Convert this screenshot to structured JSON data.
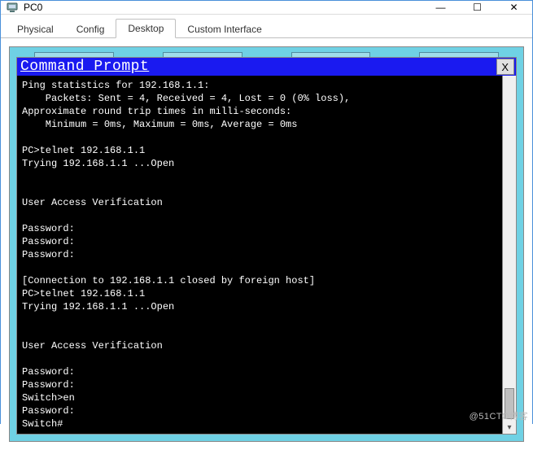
{
  "window": {
    "title": "PC0",
    "controls": {
      "minimize": "—",
      "maximize": "☐",
      "close": "✕"
    }
  },
  "tabs": [
    {
      "label": "Physical"
    },
    {
      "label": "Config"
    },
    {
      "label": "Desktop"
    },
    {
      "label": "Custom Interface"
    }
  ],
  "active_tab": "Desktop",
  "cmd": {
    "title": "Command Prompt",
    "close_label": "X",
    "lines": "Ping statistics for 192.168.1.1:\n    Packets: Sent = 4, Received = 4, Lost = 0 (0% loss),\nApproximate round trip times in milli-seconds:\n    Minimum = 0ms, Maximum = 0ms, Average = 0ms\n\nPC>telnet 192.168.1.1\nTrying 192.168.1.1 ...Open\n\n\nUser Access Verification\n\nPassword: \nPassword: \nPassword: \n\n[Connection to 192.168.1.1 closed by foreign host]\nPC>telnet 192.168.1.1\nTrying 192.168.1.1 ...Open\n\n\nUser Access Verification\n\nPassword: \nPassword: \nSwitch>en\nPassword: \nSwitch#"
  },
  "watermark": "@51CTO博客"
}
